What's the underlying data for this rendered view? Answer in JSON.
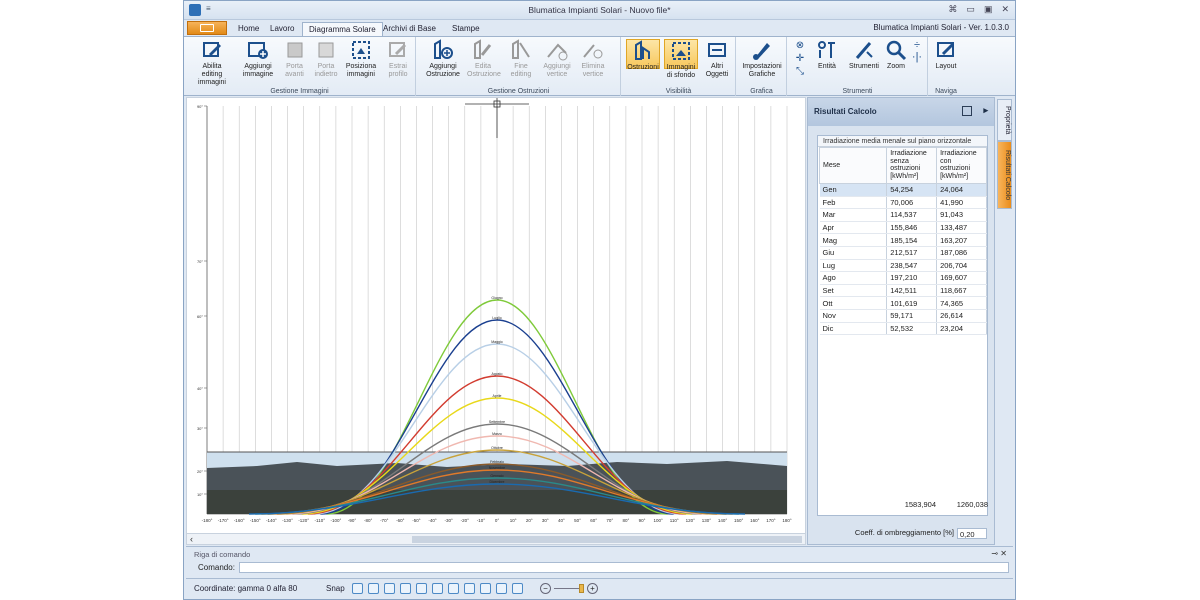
{
  "window": {
    "title": "Blumatica Impianti Solari - Nuovo file*",
    "version": "Blumatica Impianti Solari - Ver. 1.0.3.0"
  },
  "tabs": [
    "Home",
    "Lavoro",
    "Diagramma Solare",
    "Archivi di Base",
    "Stampe"
  ],
  "active_tab": "Diagramma Solare",
  "ribbon": {
    "gestione_immagini": {
      "label": "Gestione Immagini",
      "abilita": "Abilita editing immagini",
      "aggiungi": "Aggiungi immagine",
      "porta_avanti": "Porta avanti",
      "porta_indietro": "Porta indietro",
      "posiziona": "Posiziona immagini",
      "estrai": "Estrai profilo"
    },
    "gestione_ostruzioni": {
      "label": "Gestione Ostruzioni",
      "aggiungi": "Aggiungi Ostruzione",
      "edita": "Edita Ostruzione",
      "fine": "Fine editing",
      "aggiungi_vertice": "Aggiungi vertice",
      "elimina_vertice": "Elimina vertice"
    },
    "visibilita": {
      "label": "Visibilità",
      "ostruzioni": "Ostruzioni",
      "immagini_sfondo": "Immagini di sfondo",
      "altri": "Altri Oggetti"
    },
    "grafica": {
      "label": "Grafica",
      "impostazioni": "Impostazioni Grafiche"
    },
    "strumenti": {
      "label": "Strumenti",
      "entita": "Entità",
      "strumenti": "Strumenti",
      "zoom": "Zoom"
    },
    "naviga": {
      "label": "Naviga",
      "layout": "Layout"
    }
  },
  "diagram": {
    "x_ticks": [
      "-180°",
      "-170°",
      "-160°",
      "-150°",
      "-140°",
      "-130°",
      "-120°",
      "-110°",
      "-100°",
      "-90°",
      "-80°",
      "-70°",
      "-60°",
      "-50°",
      "-40°",
      "-30°",
      "-20°",
      "-10°",
      "0°",
      "10°",
      "20°",
      "30°",
      "40°",
      "50°",
      "60°",
      "70°",
      "80°",
      "90°",
      "100°",
      "110°",
      "120°",
      "130°",
      "140°",
      "150°",
      "160°",
      "170°",
      "180°"
    ],
    "y_ticks": [
      "90°",
      "70°",
      "60°",
      "40°",
      "30°",
      "20°",
      "10°"
    ],
    "curves": [
      {
        "label": "Giugno",
        "color": "#7fca3a"
      },
      {
        "label": "Luglio",
        "color": "#1a3f8f"
      },
      {
        "label": "Maggio",
        "color": "#b8cfe6"
      },
      {
        "label": "Agosto",
        "color": "#d23c30"
      },
      {
        "label": "Aprile",
        "color": "#e8d81a"
      },
      {
        "label": "Settembre",
        "color": "#7a7a7a"
      },
      {
        "label": "Marzo",
        "color": "#f0b8b0"
      },
      {
        "label": "Ottobre",
        "color": "#c8a23a"
      },
      {
        "label": "Febbraio",
        "color": "#8a5a2a"
      },
      {
        "label": "Novembre",
        "color": "#e07a2a"
      },
      {
        "label": "Gennaio",
        "color": "#2a8a8a"
      },
      {
        "label": "Dicembre",
        "color": "#1a6ab0"
      }
    ]
  },
  "results": {
    "title": "Risultati Calcolo",
    "caption": "Irradiazione media menale sul piano orizzontale",
    "headers": [
      "Mese",
      "Irradiazione senza ostruzioni [kWh/m²]",
      "Irradiazione con ostruzioni [kWh/m²]"
    ],
    "rows": [
      [
        "Gen",
        "54,254",
        "24,064"
      ],
      [
        "Feb",
        "70,006",
        "41,990"
      ],
      [
        "Mar",
        "114,537",
        "91,043"
      ],
      [
        "Apr",
        "155,846",
        "133,487"
      ],
      [
        "Mag",
        "185,154",
        "163,207"
      ],
      [
        "Giu",
        "212,517",
        "187,086"
      ],
      [
        "Lug",
        "238,547",
        "206,704"
      ],
      [
        "Ago",
        "197,210",
        "169,607"
      ],
      [
        "Set",
        "142,511",
        "118,667"
      ],
      [
        "Ott",
        "101,619",
        "74,365"
      ],
      [
        "Nov",
        "59,171",
        "26,614"
      ],
      [
        "Dic",
        "52,532",
        "23,204"
      ]
    ],
    "total_senza": "1583,904",
    "total_con": "1260,038",
    "coeff_label": "Coeff. di ombreggiamento [%]",
    "coeff_value": "0,20"
  },
  "side_tabs": [
    "Proprietà",
    "Risultati Calcolo"
  ],
  "command": {
    "title": "Riga di comando",
    "label": "Comando:",
    "value": ""
  },
  "status": {
    "coordinates": "Coordinate: gamma 0 alfa 80",
    "snap_label": "Snap"
  }
}
